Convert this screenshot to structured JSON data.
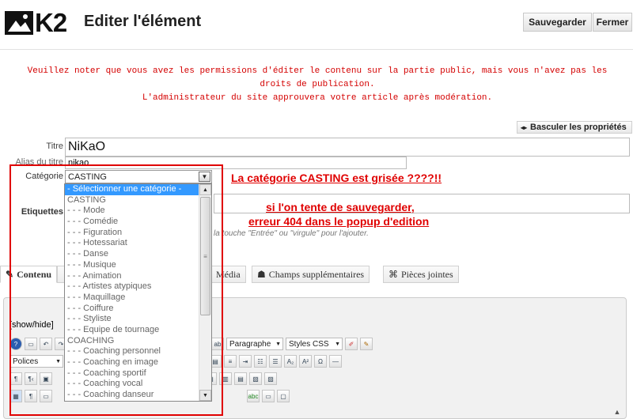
{
  "header": {
    "logo_text": "K2",
    "title": "Editer l'élément",
    "save_label": "Sauvegarder",
    "close_label": "Fermer"
  },
  "notice": {
    "line1": "Veuillez noter que vous avez les permissions d'éditer le contenu sur la partie public, mais vous n'avez pas les",
    "line2": "droits de publication.",
    "line3": "L'administrateur du site approuvera votre article après modération."
  },
  "toggle_label": "Basculer les propriétés",
  "form": {
    "title_label": "Titre",
    "title_value": "NiKaO",
    "alias_label": "Alias du titre",
    "alias_value": "nikao",
    "category_label": "Catégorie",
    "category_selected": "CASTING",
    "tags_label": "Etiquettes",
    "tags_hint": "la touche \"Entrée\" ou \"virgule\" pour l'ajouter."
  },
  "category_options": [
    "- Sélectionner une catégorie -",
    "CASTING",
    "- - - Mode",
    "- - - Comédie",
    "- - - Figuration",
    "- - - Hotessariat",
    "- - - Danse",
    "- - - Musique",
    "- - - Animation",
    "- - - Artistes atypiques",
    "- - - Maquillage",
    "- - - Coiffure",
    "- - - Styliste",
    "- - - Equipe de tournage",
    "COACHING",
    "- - - Coaching personnel",
    "- - - Coaching en image",
    "- - - Coaching sportif",
    "- - - Coaching vocal",
    "- - - Coaching danseur"
  ],
  "annotations": {
    "a1": "La catégorie CASTING est grisée ????!!",
    "a2": "si l'on tente de sauvegarder,",
    "a3": "erreur 404 dans le popup d'edition"
  },
  "tabs": {
    "contenu": "Contenu",
    "media": "Média",
    "champs": "Champs supplémentaires",
    "pieces": "Pièces jointes"
  },
  "editor": {
    "showhide": "[show/hide]",
    "format_select": "Paragraphe",
    "styles_select": "Styles CSS",
    "fonts_select": "Polices"
  },
  "colors": {
    "notice_red": "#d40000",
    "annotation_red": "#e00000",
    "highlight_blue": "#3399ff"
  }
}
